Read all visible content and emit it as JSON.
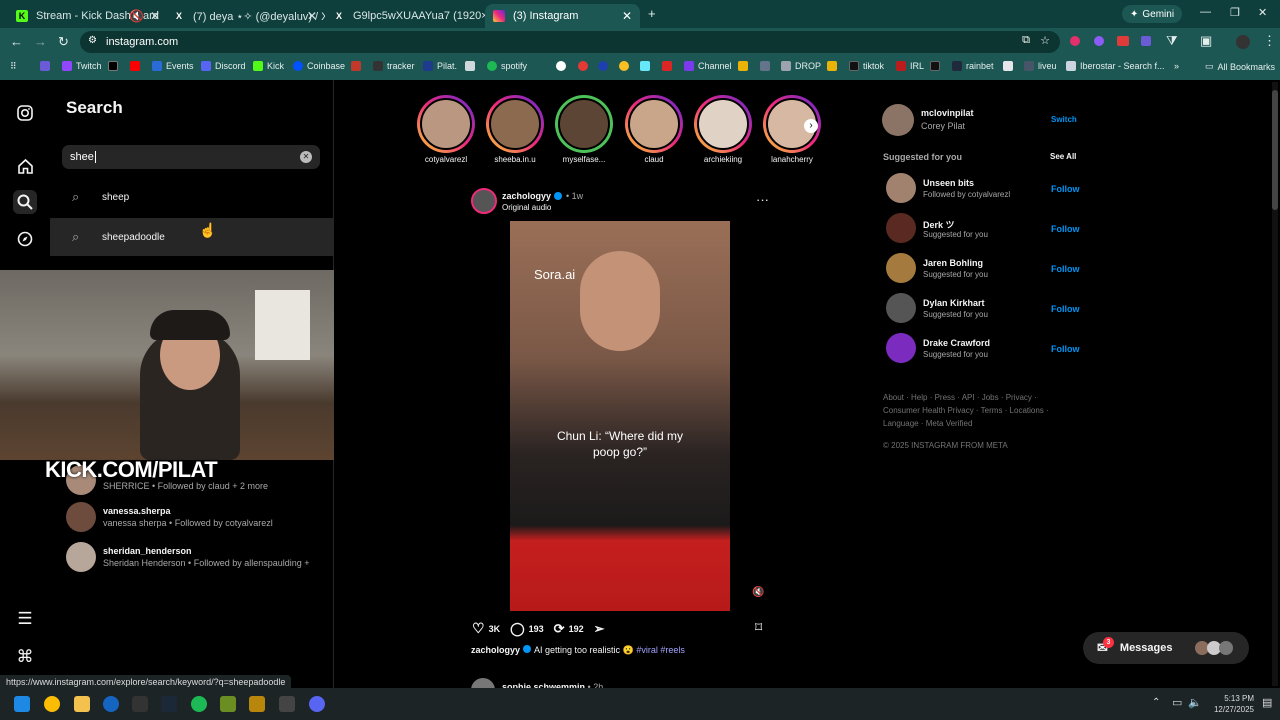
{
  "browser": {
    "tabs": [
      {
        "title": "Stream - Kick Dashboard",
        "favicon": "kick-icon",
        "color": "#53fc18"
      },
      {
        "title": "(7) deya ⋆✧ (@deyaluv) / X",
        "favicon": "x-icon",
        "color": "#ffffff"
      },
      {
        "title": "G9lpc5wXUAAYua7 (1920×1080)",
        "favicon": "x-icon",
        "color": "#ffffff"
      },
      {
        "title": "(3) Instagram",
        "favicon": "instagram-icon",
        "color": "#e1306c"
      }
    ],
    "gemini_label": "Gemini",
    "url": "instagram.com",
    "bookmarks": [
      "Twitch",
      "Events",
      "Discord",
      "Kick",
      "Coinbase",
      "tracker",
      "Pilat.",
      "spotify",
      "Channel",
      "DROP",
      "tiktok",
      "IRL",
      "rainbet",
      "liveu",
      "Iberostar - Search f...",
      "All Bookmarks"
    ],
    "status_url": "https://www.instagram.com/explore/search/keyword/?q=sheepadoodle"
  },
  "search": {
    "title": "Search",
    "query": "shee",
    "suggestions": [
      "sheep",
      "sheepadoodle"
    ],
    "accounts": [
      {
        "name": "",
        "sub": "SHERRICE • Followed by claud + 2 more"
      },
      {
        "name": "vanessa.sherpa",
        "sub": "vanessa sherpa • Followed by cotyalvarezl"
      },
      {
        "name": "sheridan_henderson",
        "sub": "Sheridan Henderson • Followed by allenspaulding +"
      }
    ]
  },
  "overlay": {
    "kick_text": "KICK.COM/PILAT"
  },
  "stories": [
    "cotyalvarezl",
    "sheeba.in.u",
    "myselfase...",
    "claud",
    "archiekiing",
    "lanahcherry"
  ],
  "post": {
    "author": "zachologyy",
    "time": "• 1w",
    "audio": "Original audio",
    "video_text_top": "Sora.ai",
    "video_caption": "Chun Li: “Where did my poop go?”",
    "likes": "3K",
    "comments": "193",
    "reposts": "192",
    "caption_user": "zachologyy",
    "caption_text": "AI getting too realistic",
    "caption_tags": "#viral #reels",
    "next_author": "sophie.schwemmin",
    "next_time": "• 2h"
  },
  "profile": {
    "username": "mclovinpilat",
    "name": "Corey Pilat",
    "switch": "Switch"
  },
  "suggested": {
    "title": "Suggested for you",
    "see_all": "See All",
    "follow_label": "Follow",
    "items": [
      {
        "name": "Unseen bits",
        "sub": "Followed by cotyalvarezl"
      },
      {
        "name": "Derk ツ",
        "sub": "Suggested for you"
      },
      {
        "name": "Jaren Bohling",
        "sub": "Suggested for you"
      },
      {
        "name": "Dylan Kirkhart",
        "sub": "Suggested for you"
      },
      {
        "name": "Drake Crawford",
        "sub": "Suggested for you"
      }
    ]
  },
  "footer": {
    "line1": "About · Help · Press · API · Jobs · Privacy ·",
    "line2": "Consumer Health Privacy · Terms · Locations ·",
    "line3": "Language · Meta Verified",
    "copyright": "© 2025 INSTAGRAM FROM META"
  },
  "messages": {
    "label": "Messages",
    "badge": "3"
  },
  "clock": {
    "time": "5:13 PM",
    "date": "12/27/2025"
  }
}
